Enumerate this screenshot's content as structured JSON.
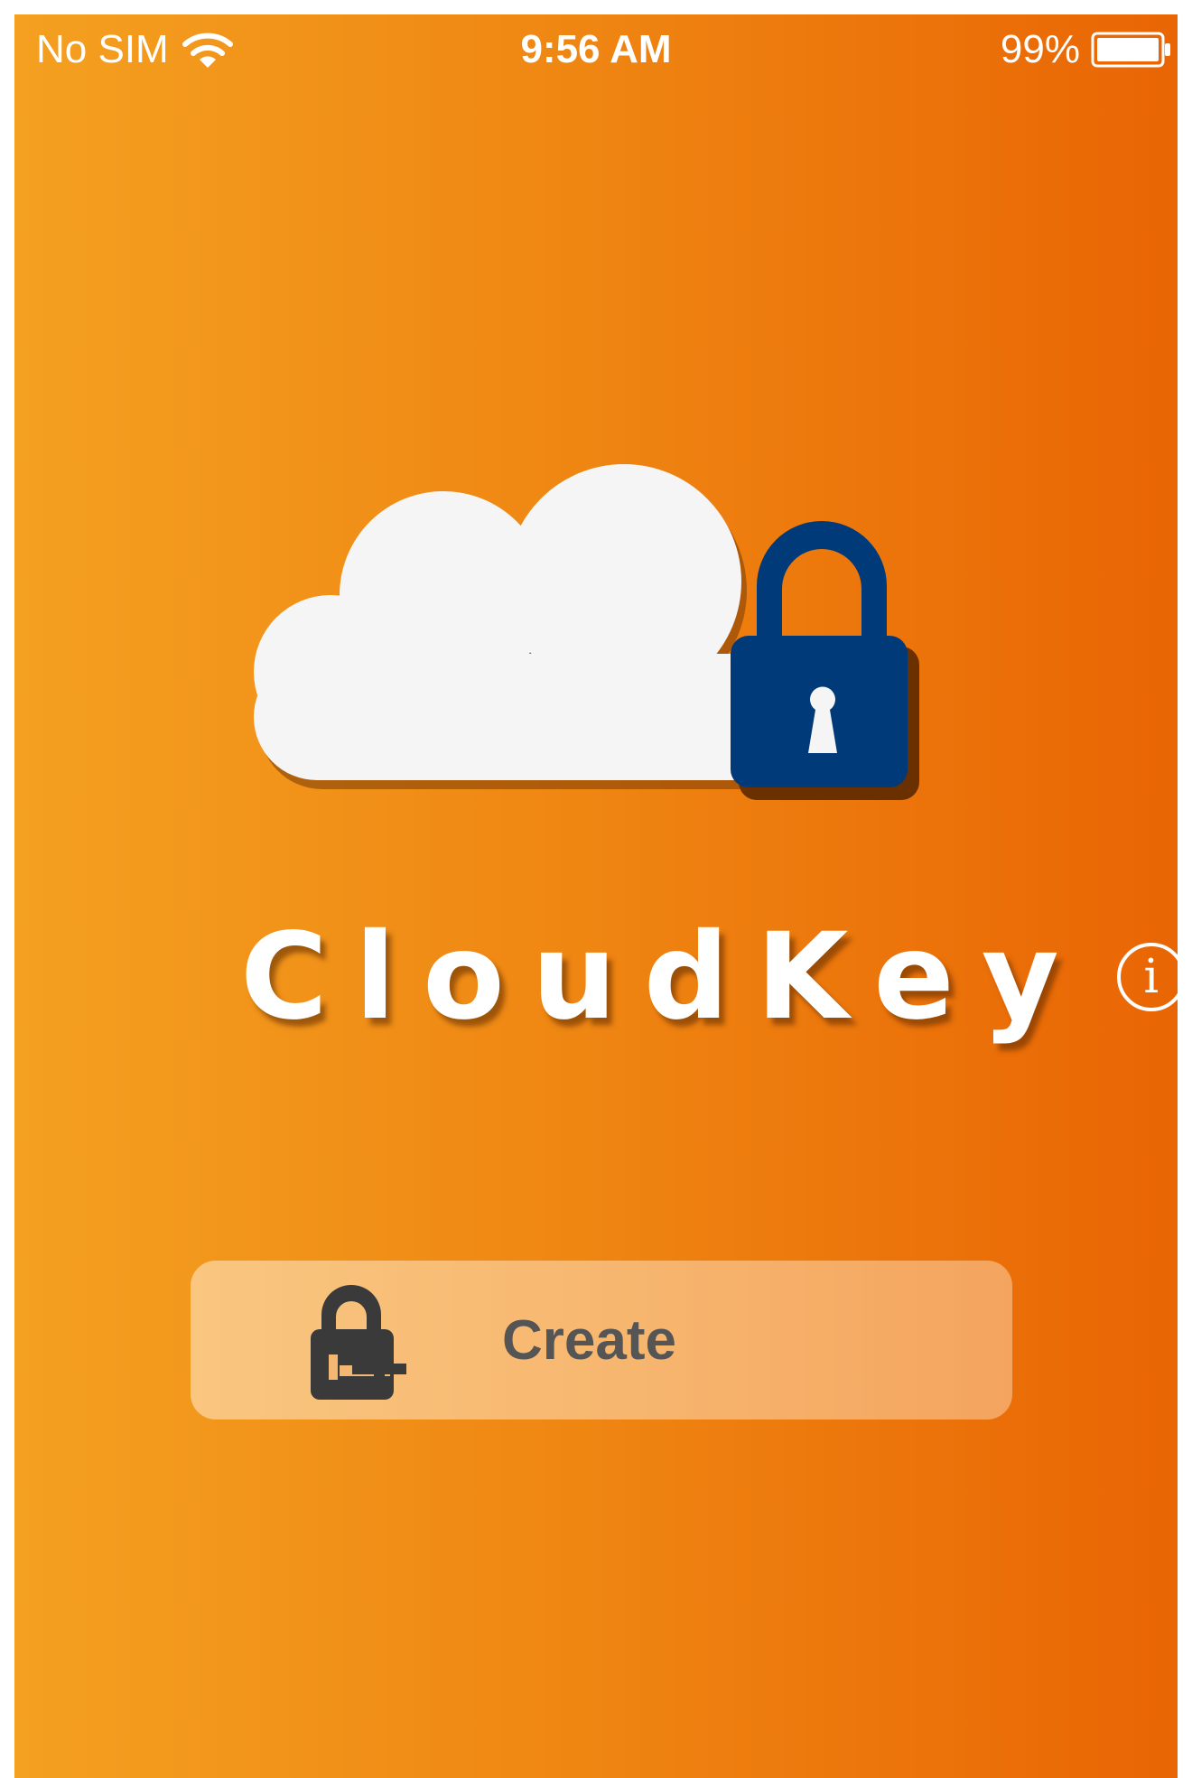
{
  "status_bar": {
    "carrier": "No SIM",
    "time": "9:56 AM",
    "battery_percent": "99%",
    "icons": [
      "wifi-icon",
      "battery-icon"
    ]
  },
  "app": {
    "name": "CloudKey",
    "info_glyph": "i"
  },
  "create_button": {
    "label": "Create",
    "icon": "lock-plus-icon"
  },
  "logo": {
    "icons": [
      "cloud-icon",
      "padlock-icon"
    ]
  },
  "colors": {
    "gradient_start": "#f4a020",
    "gradient_end": "#e96504",
    "lock_blue": "#003a78",
    "cloud_white": "#f5f5f5",
    "button_text": "#555555"
  }
}
